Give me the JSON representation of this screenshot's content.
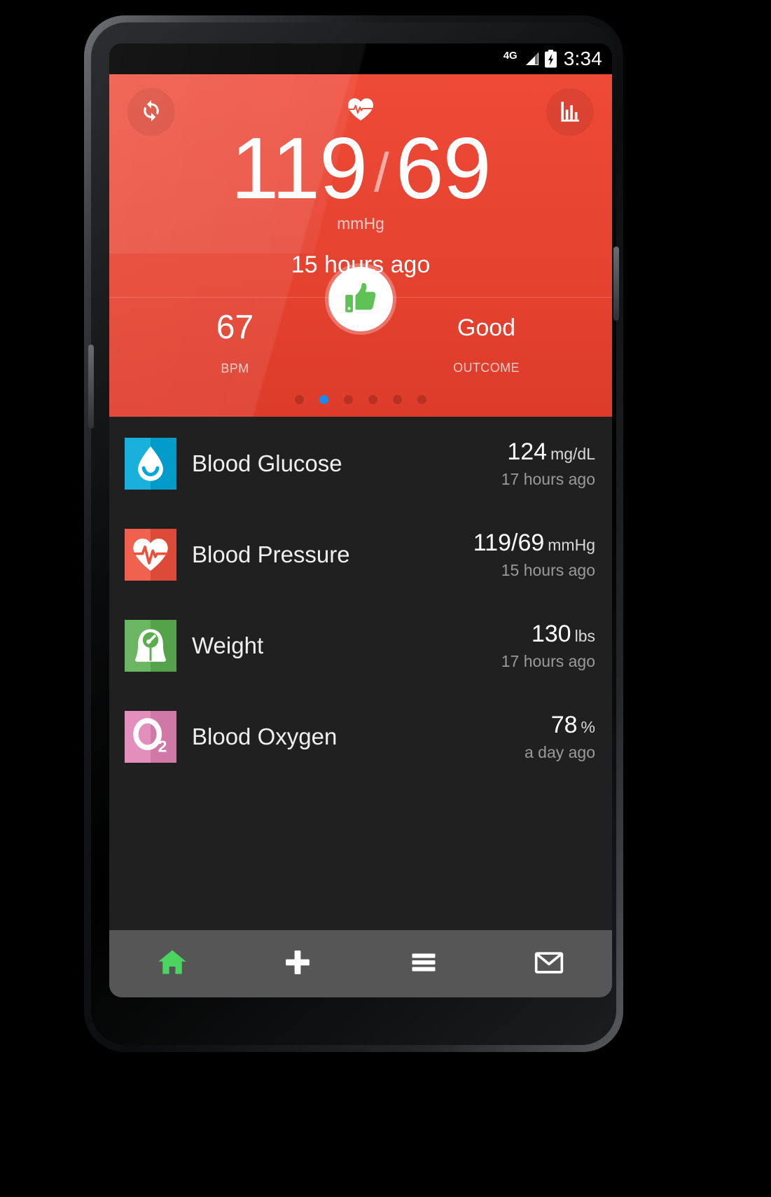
{
  "statusbar": {
    "network": "4G",
    "time": "3:34",
    "signal_icon": "signal-bars-icon",
    "battery_icon": "battery-charging-icon"
  },
  "hero": {
    "refresh_icon": "refresh-icon",
    "chart_icon": "bar-chart-icon",
    "brand_icon": "heartbeat-icon",
    "systolic": "119",
    "separator": "/",
    "diastolic": "69",
    "unit": "mmHg",
    "timestamp": "15 hours ago",
    "pulse": {
      "value": "67",
      "label": "BPM"
    },
    "outcome": {
      "value": "Good",
      "label": "OUTCOME",
      "badge_icon": "thumbs-up-icon"
    },
    "accent_color": "#e1402f",
    "pager": {
      "count": 6,
      "active_index": 1,
      "active_color": "#1e88f0"
    }
  },
  "list": {
    "items": [
      {
        "title": "Blood Glucose",
        "value": "124",
        "unit": "mg/dL",
        "time": "17 hours ago",
        "icon": "water-drop-smiley-icon",
        "icon_bg": "#00a7d8"
      },
      {
        "title": "Blood Pressure",
        "value": "119/69",
        "unit": "mmHg",
        "time": "15 hours ago",
        "icon": "heart-ecg-icon",
        "icon_bg": "#ee4f3b"
      },
      {
        "title": "Weight",
        "value": "130",
        "unit": "lbs",
        "time": "17 hours ago",
        "icon": "weight-scale-icon",
        "icon_bg": "#5aae50"
      },
      {
        "title": "Blood Oxygen",
        "value": "78",
        "unit": "%",
        "time": "a day ago",
        "icon": "o2-icon",
        "icon_bg": "#e082b4"
      }
    ]
  },
  "navbar": {
    "items": [
      {
        "name": "home",
        "icon": "home-icon",
        "active": true
      },
      {
        "name": "add",
        "icon": "plus-icon",
        "active": false
      },
      {
        "name": "menu",
        "icon": "hamburger-menu-icon",
        "active": false
      },
      {
        "name": "messages",
        "icon": "envelope-icon",
        "active": false
      }
    ],
    "active_color": "#4bd45f",
    "background": "#565656"
  }
}
